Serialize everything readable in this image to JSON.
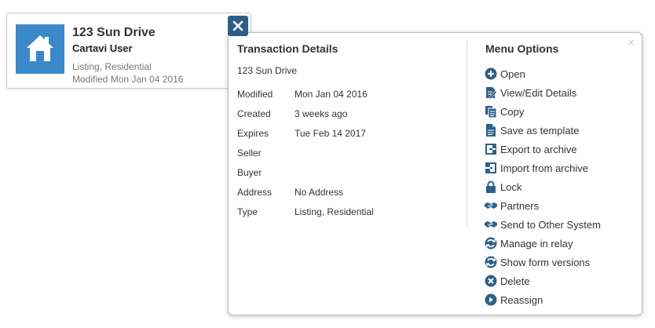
{
  "card": {
    "title": "123 Sun Drive",
    "user": "Cartavi User",
    "type": "Listing, Residential",
    "modified": "Modified Mon Jan 04 2016",
    "icon": "house-icon",
    "icon_bg": "#3b89c9",
    "close_icon": "close-icon",
    "close_bg": "#2e5f8a"
  },
  "popup": {
    "close_glyph": "×",
    "details": {
      "heading": "Transaction Details",
      "address": "123 Sun Drive",
      "rows": [
        {
          "label": "Modified",
          "value": "Mon Jan 04 2016"
        },
        {
          "label": "Created",
          "value": "3 weeks ago"
        },
        {
          "label": "Expires",
          "value": "Tue Feb 14 2017"
        },
        {
          "label": "Seller",
          "value": ""
        },
        {
          "label": "Buyer",
          "value": ""
        },
        {
          "label": "Address",
          "value": "No Address"
        },
        {
          "label": "Type",
          "value": "Listing, Residential"
        }
      ]
    },
    "menu": {
      "heading": "Menu Options",
      "icon_color": "#2e5f8a",
      "items": [
        {
          "label": "Open",
          "icon": "plus-circle-icon"
        },
        {
          "label": "View/Edit Details",
          "icon": "edit-document-icon"
        },
        {
          "label": "Copy",
          "icon": "copy-icon"
        },
        {
          "label": "Save as template",
          "icon": "document-icon"
        },
        {
          "label": "Export to archive",
          "icon": "export-icon"
        },
        {
          "label": "Import from archive",
          "icon": "import-icon"
        },
        {
          "label": "Lock",
          "icon": "lock-icon"
        },
        {
          "label": "Partners",
          "icon": "handshake-icon"
        },
        {
          "label": "Send to Other System",
          "icon": "handshake-icon"
        },
        {
          "label": "Manage in relay",
          "icon": "relay-icon"
        },
        {
          "label": "Show form versions",
          "icon": "relay-icon"
        },
        {
          "label": "Delete",
          "icon": "x-circle-icon"
        },
        {
          "label": "Reassign",
          "icon": "arrow-circle-icon"
        }
      ]
    }
  }
}
